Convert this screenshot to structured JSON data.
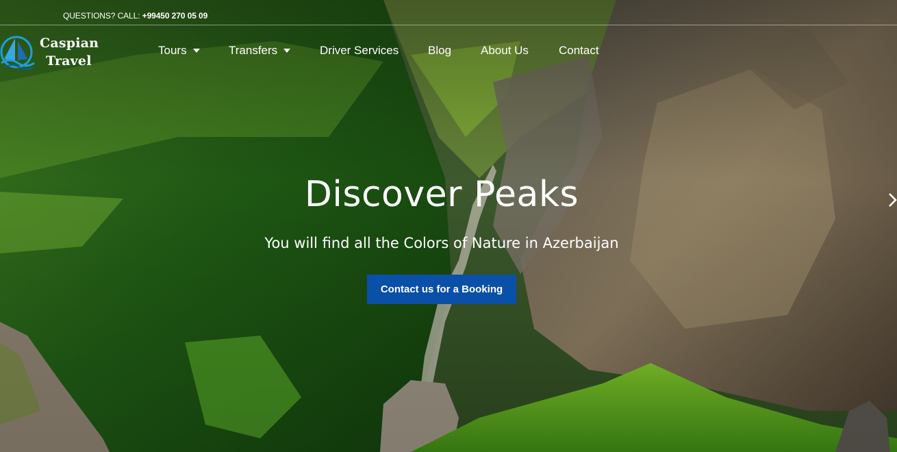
{
  "topbar": {
    "question_label": "QUESTIONS? CALL: ",
    "phone": "+99450 270 05 09"
  },
  "brand": {
    "line1": "Caspian",
    "line2": "Travel",
    "logo_icon": "sailboat-wave-icon"
  },
  "nav": {
    "items": [
      {
        "label": "Tours",
        "has_dropdown": true
      },
      {
        "label": "Transfers",
        "has_dropdown": true
      },
      {
        "label": "Driver Services",
        "has_dropdown": false
      },
      {
        "label": "Blog",
        "has_dropdown": false
      },
      {
        "label": "About Us",
        "has_dropdown": false
      },
      {
        "label": "Contact",
        "has_dropdown": false
      }
    ]
  },
  "hero": {
    "title": "Discover Peaks",
    "subtitle": "You will find all the Colors of Nature in Azerbaijan",
    "cta_label": "Contact us for a Booking",
    "next_icon": "chevron-right-icon"
  },
  "colors": {
    "accent": "#0a4fa8",
    "text": "#ffffff"
  }
}
